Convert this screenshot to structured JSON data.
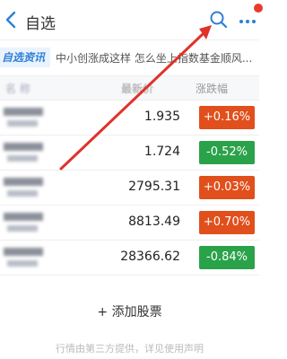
{
  "header": {
    "title": "自选",
    "back_icon": "chevron-left-icon",
    "search_icon": "search-icon",
    "more_icon": "more-dots-icon"
  },
  "news": {
    "badge": "自选资讯",
    "text": "中小创涨成这样 怎么坐上指数基金顺风..."
  },
  "table": {
    "headers": {
      "price": "最新价",
      "change": "涨跌幅"
    },
    "rows": [
      {
        "price": "1.935",
        "change": "+0.16%",
        "direction": "up"
      },
      {
        "price": "1.724",
        "change": "-0.52%",
        "direction": "down"
      },
      {
        "price": "2795.31",
        "change": "+0.03%",
        "direction": "up"
      },
      {
        "price": "8813.49",
        "change": "+0.70%",
        "direction": "up"
      },
      {
        "price": "28366.62",
        "change": "-0.84%",
        "direction": "down"
      }
    ]
  },
  "add_stock_label": "+ 添加股票",
  "footer_text": "行情由第三方提供，详见使用声明",
  "colors": {
    "up": "#e14f1c",
    "down": "#2aa24a",
    "accent": "#2f7fd6",
    "annotation_arrow": "#e0322a"
  }
}
